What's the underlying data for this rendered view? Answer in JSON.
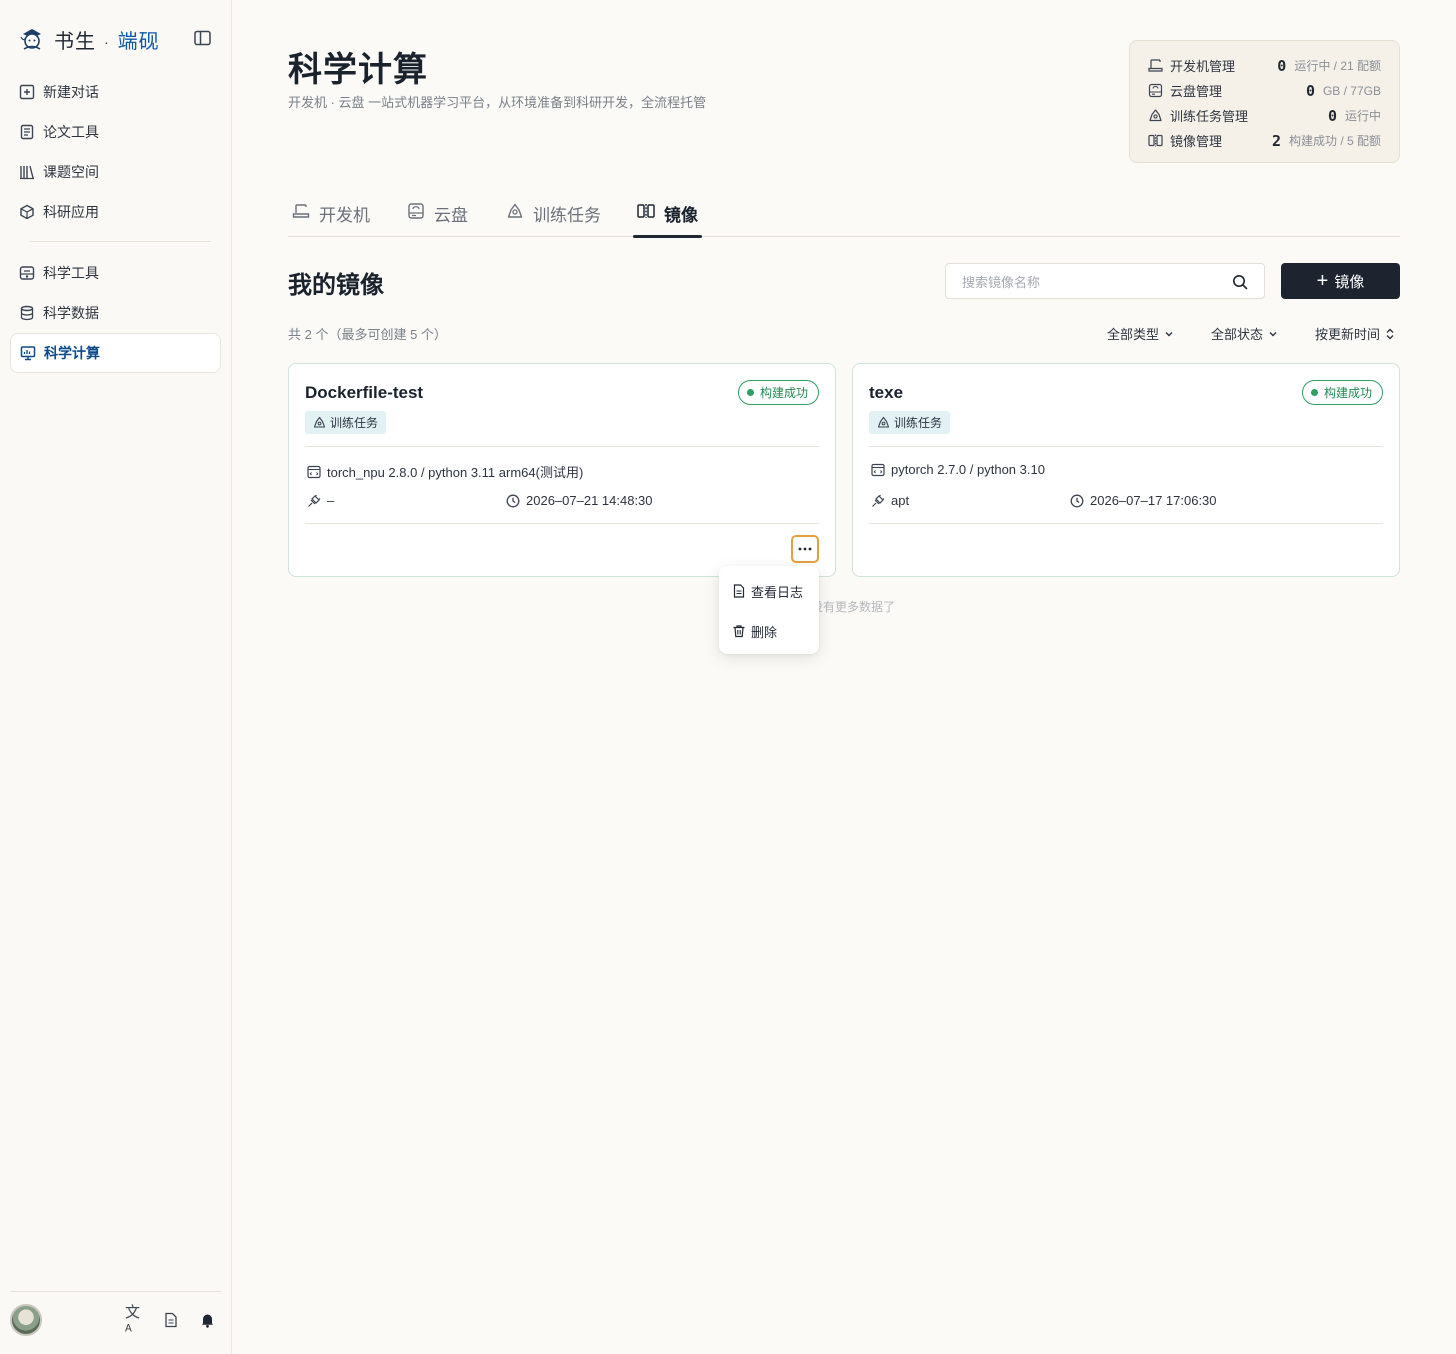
{
  "brand": {
    "name_main": "书生",
    "separator": "·",
    "name_accent": "端砚"
  },
  "sidebar": {
    "items_top": [
      {
        "label": "新建对话",
        "icon": "plus-square-icon"
      },
      {
        "label": "论文工具",
        "icon": "document-icon"
      },
      {
        "label": "课题空间",
        "icon": "library-icon"
      },
      {
        "label": "科研应用",
        "icon": "cube-icon"
      }
    ],
    "items_bottom": [
      {
        "label": "科学工具",
        "icon": "toolbox-icon"
      },
      {
        "label": "科学数据",
        "icon": "database-icon"
      },
      {
        "label": "科学计算",
        "icon": "monitor-icon",
        "active": true
      }
    ],
    "footer_icons": [
      "translate-icon",
      "file-icon",
      "bell-icon"
    ],
    "translate_glyph": "文ᴬ"
  },
  "header": {
    "title": "科学计算",
    "subtitle": "开发机 · 云盘 一站式机器学习平台，从环境准备到科研开发，全流程托管"
  },
  "summary": [
    {
      "label": "开发机管理",
      "num": "0",
      "unit": "运行中 / 21 配额",
      "icon": "devmachine-icon"
    },
    {
      "label": "云盘管理",
      "num": "0",
      "unit": "GB / 77GB",
      "icon": "disk-icon"
    },
    {
      "label": "训练任务管理",
      "num": "0",
      "unit": "运行中",
      "icon": "training-icon"
    },
    {
      "label": "镜像管理",
      "num": "2",
      "unit": "构建成功 / 5 配额",
      "icon": "image-icon"
    }
  ],
  "tabs": [
    {
      "label": "开发机",
      "icon": "devmachine-icon"
    },
    {
      "label": "云盘",
      "icon": "disk-icon"
    },
    {
      "label": "训练任务",
      "icon": "training-icon"
    },
    {
      "label": "镜像",
      "icon": "image-icon",
      "active": true
    }
  ],
  "section": {
    "title": "我的镜像",
    "search_placeholder": "搜索镜像名称",
    "add_label": "镜像",
    "add_plus": "+",
    "count_text": "共 2 个（最多可创建 5 个）",
    "filter_type": "全部类型",
    "filter_status": "全部状态",
    "sort": "按更新时间"
  },
  "cards": [
    {
      "name": "Dockerfile-test",
      "status": "构建成功",
      "tag": "训练任务",
      "base": "torch_npu 2.8.0 / python 3.11 arm64(测试用)",
      "install": "–",
      "time": "2026–07–21 14:48:30"
    },
    {
      "name": "texe",
      "status": "构建成功",
      "tag": "训练任务",
      "base": "pytorch 2.7.0 / python 3.10",
      "install": "apt",
      "time": "2026–07–17 17:06:30"
    }
  ],
  "no_more_text": "没有更多数据了",
  "dropdown": {
    "view_log": "查看日志",
    "delete": "删除"
  },
  "colors": {
    "accent": "#0d5aa7",
    "success": "#2f9e63",
    "focus": "#e3a13d",
    "primary_button": "#1d2430"
  }
}
